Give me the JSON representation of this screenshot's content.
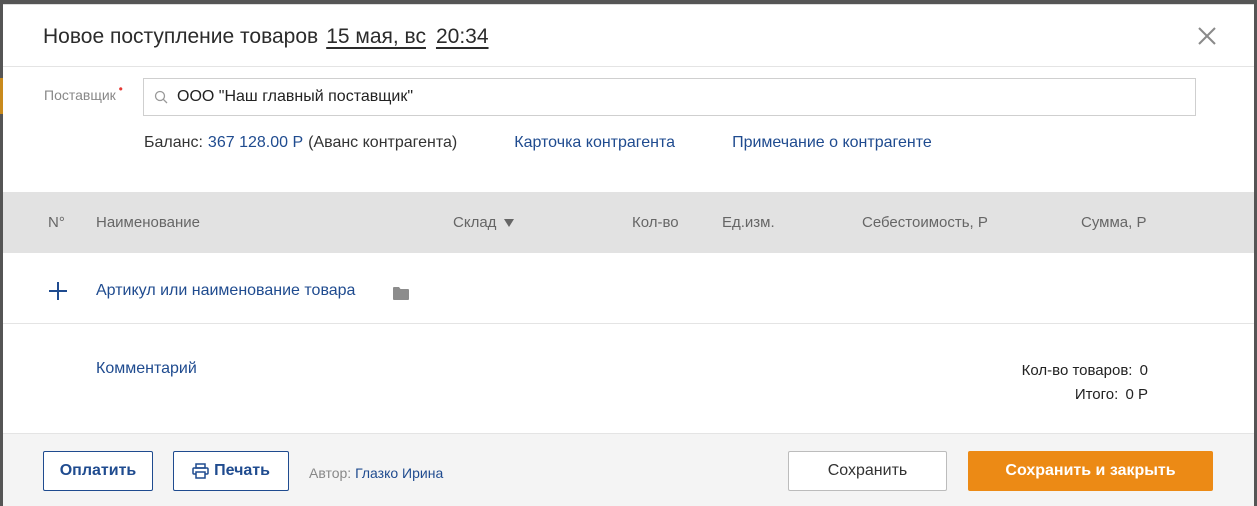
{
  "dialog": {
    "title": "Новое поступление товаров",
    "date": "15 мая, вс",
    "time": "20:34"
  },
  "supplier": {
    "label": "Поставщик",
    "required_mark": "•",
    "value": "ООО \"Наш главный поставщик\"",
    "balance_label": "Баланс:",
    "balance_value": "367 128.00 Р",
    "balance_note": "(Аванс контрагента)",
    "card_link": "Карточка контрагента",
    "note_link": "Примечание о контрагенте"
  },
  "table": {
    "columns": {
      "num": "N°",
      "name": "Наименование",
      "warehouse": "Склад",
      "qty": "Кол-во",
      "unit": "Ед.изм.",
      "cost": "Себестоимость, Р",
      "sum": "Сумма, Р"
    },
    "add_item_label": "Артикул или наименование товара"
  },
  "summary": {
    "comment_link": "Комментарий",
    "count_label": "Кол-во товаров:",
    "count_value": "0",
    "total_label": "Итого:",
    "total_value": "0 Р"
  },
  "footer": {
    "pay": "Оплатить",
    "print": "Печать",
    "author_label": "Автор:",
    "author_name": "Глазко Ирина",
    "save": "Сохранить",
    "save_close": "Сохранить и закрыть"
  },
  "colors": {
    "accent": "#1f4b8f",
    "primary_button": "#ec8a15",
    "required": "#e53935",
    "table_header_bg": "#e2e2e2"
  },
  "icons": [
    "close-icon",
    "search-icon",
    "plus-icon",
    "folder-icon",
    "printer-icon",
    "sort-down-icon"
  ]
}
